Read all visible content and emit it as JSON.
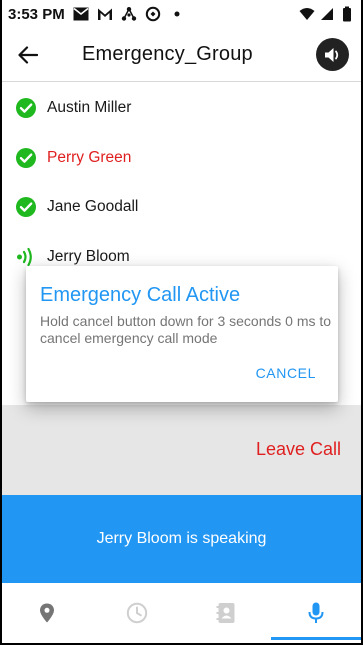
{
  "status_bar": {
    "time": "3:53 PM",
    "left_icons": [
      "mail-icon",
      "gmail-icon",
      "hub-icon",
      "data-saver-icon",
      "dot-icon"
    ],
    "right_icons": [
      "wifi-icon",
      "signal-icon",
      "battery-icon"
    ]
  },
  "app_bar": {
    "title": "Emergency_Group"
  },
  "members": [
    {
      "name": "Austin Miller",
      "status": "connected",
      "name_color": "#1a1a1a"
    },
    {
      "name": "Perry Green",
      "status": "connected",
      "name_color": "#e02020"
    },
    {
      "name": "Jane Goodall",
      "status": "connected",
      "name_color": "#1a1a1a"
    },
    {
      "name": "Jerry Bloom",
      "status": "speaking",
      "name_color": "#1a1a1a"
    }
  ],
  "dialog": {
    "title": "Emergency Call Active",
    "message": "Hold cancel button down for 3 seconds 0 ms to cancel emergency call mode",
    "cancel_label": "CANCEL"
  },
  "leave_call_label": "Leave Call",
  "speaking_text": "Jerry Bloom is speaking",
  "bottom_nav": [
    {
      "icon": "location-pin-icon",
      "active": false
    },
    {
      "icon": "clock-icon",
      "active": false
    },
    {
      "icon": "contacts-icon",
      "active": false
    },
    {
      "icon": "microphone-icon",
      "active": true
    }
  ],
  "colors": {
    "accent_blue": "#2196f3",
    "alert_red": "#e02020",
    "check_green": "#1fb81f"
  }
}
